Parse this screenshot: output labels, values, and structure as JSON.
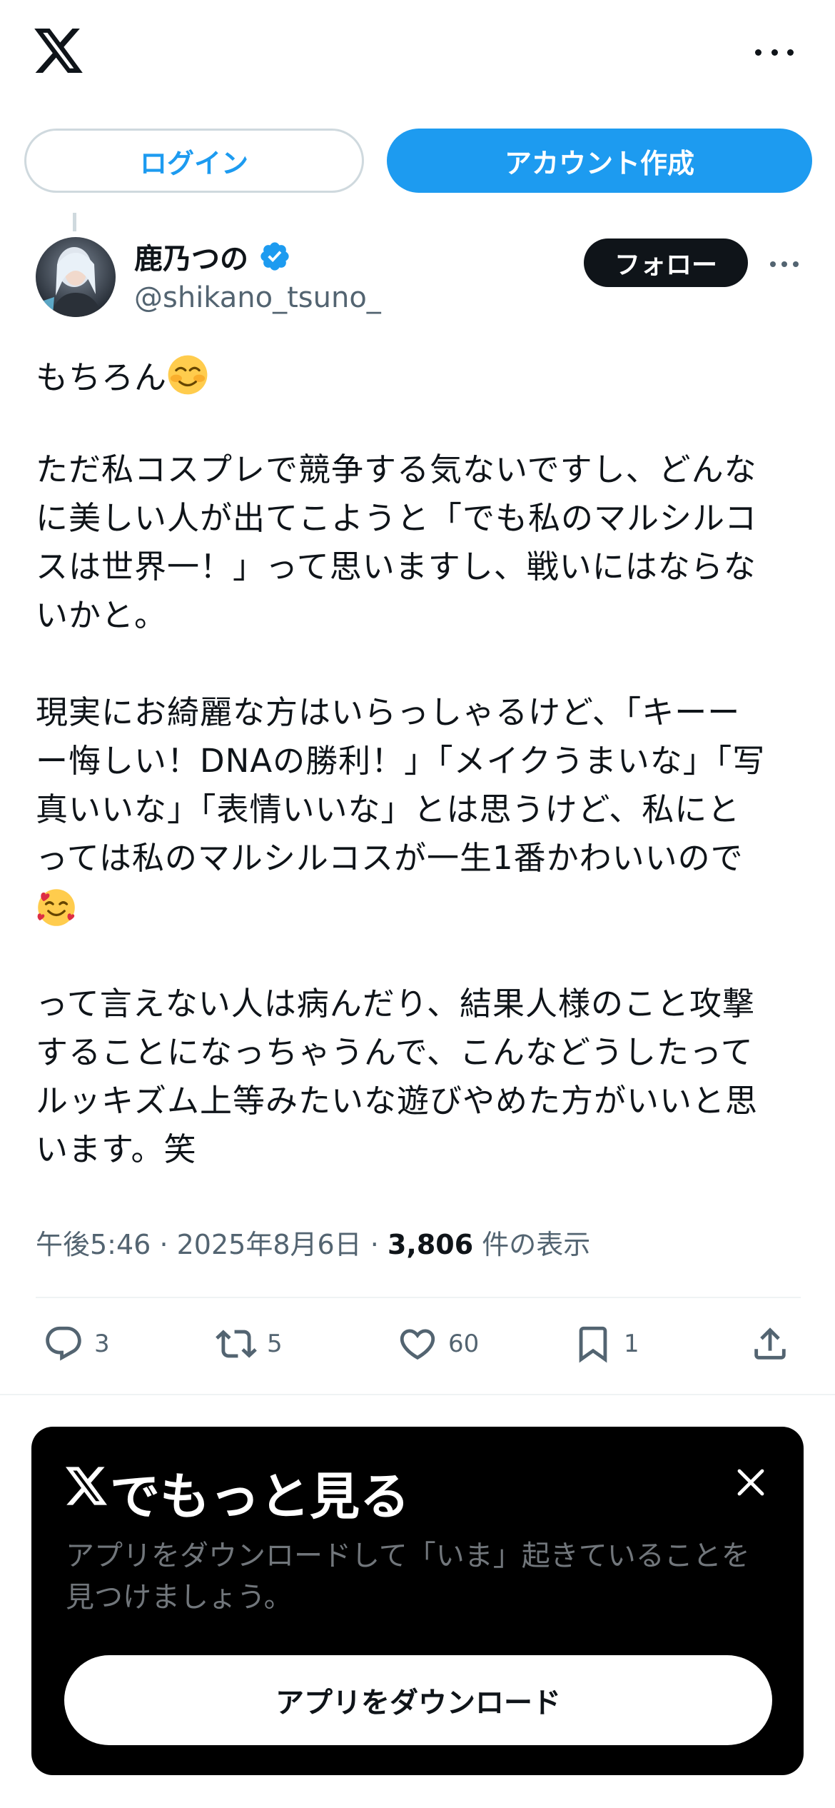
{
  "header": {
    "logo_icon": "x-logo-icon",
    "more_icon": "more-dots-icon"
  },
  "auth": {
    "login_label": "ログイン",
    "signup_label": "アカウント作成"
  },
  "author": {
    "name": "鹿乃つの",
    "handle": "@shikano_tsuno_",
    "verified": true,
    "follow_label": "フォロー"
  },
  "tweet": {
    "lines": [
      "もちろん",
      "",
      "ただ私コスプレで競争する気ないですし、どんな",
      "に美しい人が出てこようと「でも私のマルシルコ",
      "スは世界一！」って思いますし、戦いにはならな",
      "いかと。",
      "",
      "現実にお綺麗な方はいらっしゃるけど、「キーー",
      "ー悔しい！DNAの勝利！」「メイクうまいな」「写",
      "真いいな」「表情いいな」とは思うけど、私にと",
      "っては私のマルシルコスが一生1番かわいいので",
      "",
      "",
      "って言えない人は病んだり、結果人様のこと攻撃",
      "することになっちゃうんで、こんなどうしたって",
      "ルッキズム上等みたいな遊びやめた方がいいと思",
      "います。笑"
    ],
    "emoji_1": "smiling-face-emoji",
    "emoji_2": "smiling-face-with-hearts-emoji"
  },
  "meta": {
    "time": "午後5:46",
    "separator": "·",
    "date": "2025年8月6日",
    "views_count": "3,806",
    "views_label": "件の表示"
  },
  "actions": {
    "replies": "3",
    "reposts": "5",
    "likes": "60",
    "bookmarks": "1"
  },
  "promo": {
    "title": "でもっと見る",
    "description": "アプリをダウンロードして「いま」起きていることを見つけましょう。",
    "button_label": "アプリをダウンロード"
  },
  "colors": {
    "accent": "#1d9bf0",
    "text": "#0f1419",
    "secondary": "#536471",
    "border": "#cfd9de",
    "divider": "#eff3f4"
  }
}
